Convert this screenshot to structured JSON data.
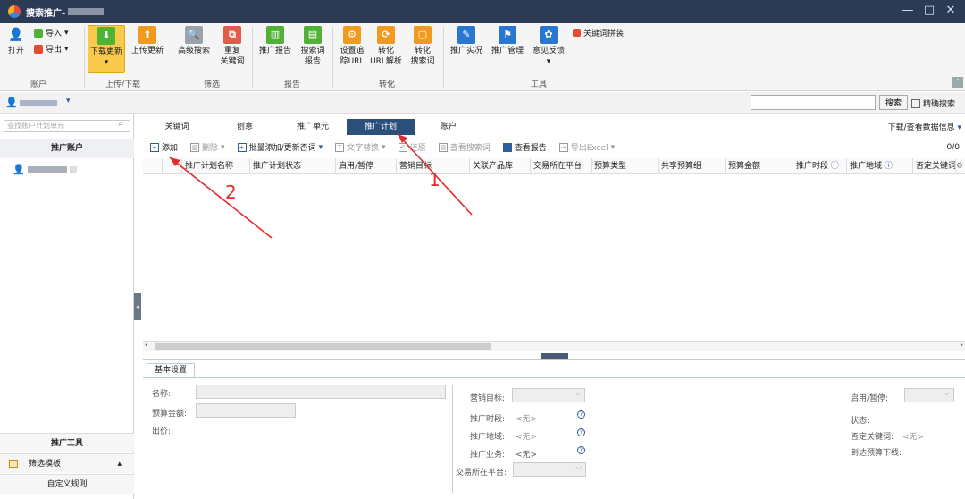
{
  "window": {
    "title": "搜索推广-",
    "controls": [
      "—",
      "□",
      "✕"
    ]
  },
  "ribbon": {
    "open": "打开",
    "import": "导入",
    "export": "导出",
    "download_update": "下载更新",
    "upload_update": "上传更新",
    "advanced_search": "高级搜索",
    "duplicate_keywords": [
      "重复",
      "关键词"
    ],
    "promotion_report": "推广报告",
    "search_term_report": [
      "搜索词",
      "报告"
    ],
    "set_tracking_url": [
      "设置追",
      "踪URL"
    ],
    "convert_url_parse": [
      "转化",
      "URL解析"
    ],
    "convert_search_term": [
      "转化",
      "搜索词"
    ],
    "promo_live": "推广实况",
    "promo_manage": "推广管理",
    "feedback": "意见反馈",
    "keyword_combine": "关键词拼装",
    "groups": {
      "account": "账户",
      "upload_download": "上传/下载",
      "filter": "筛选",
      "report": "报告",
      "convert": "转化",
      "tools": "工具"
    }
  },
  "userbar": {
    "search_button": "搜索",
    "exact_search": "精确搜索"
  },
  "sidebar": {
    "search_placeholder": "查找账户计划单元",
    "header": "推广账户",
    "footer": {
      "tools": "推广工具",
      "filter_template": "筛选模板",
      "custom_rules": "自定义规则"
    }
  },
  "tabs": [
    "关键词",
    "创意",
    "推广单元",
    "推广计划",
    "账户"
  ],
  "download_info": "下载/查看数据信息",
  "toolbar": {
    "add": "添加",
    "delete": "删除",
    "batch": "批量添加/更新否词",
    "text_replace": "文字替换",
    "restore": "还原",
    "view_search_terms": "查看搜索词",
    "view_report": "查看报告",
    "export_excel": "导出Excel",
    "count": "0/0"
  },
  "columns": [
    "推广计划名称",
    "推广计划状态",
    "启用/暂停",
    "营销目标",
    "关联产品库",
    "交易所在平台",
    "预算类型",
    "共享预算组",
    "预算金额",
    "推广时段",
    "推广地域",
    "否定关键词"
  ],
  "details": {
    "tab": "基本设置",
    "name": "名称:",
    "budget": "预算金额:",
    "bid": "出价:",
    "marketing_goal": "营销目标:",
    "schedule": "推广时段:",
    "region": "推广地域:",
    "business": "推广业务:",
    "platform": "交易所在平台:",
    "none": "<无>",
    "enable_pause": "启用/暂停:",
    "status": "状态:",
    "negative_keywords": "否定关键词:",
    "budget_offline": "到达预算下线:"
  },
  "annotations": [
    "1",
    "2"
  ]
}
